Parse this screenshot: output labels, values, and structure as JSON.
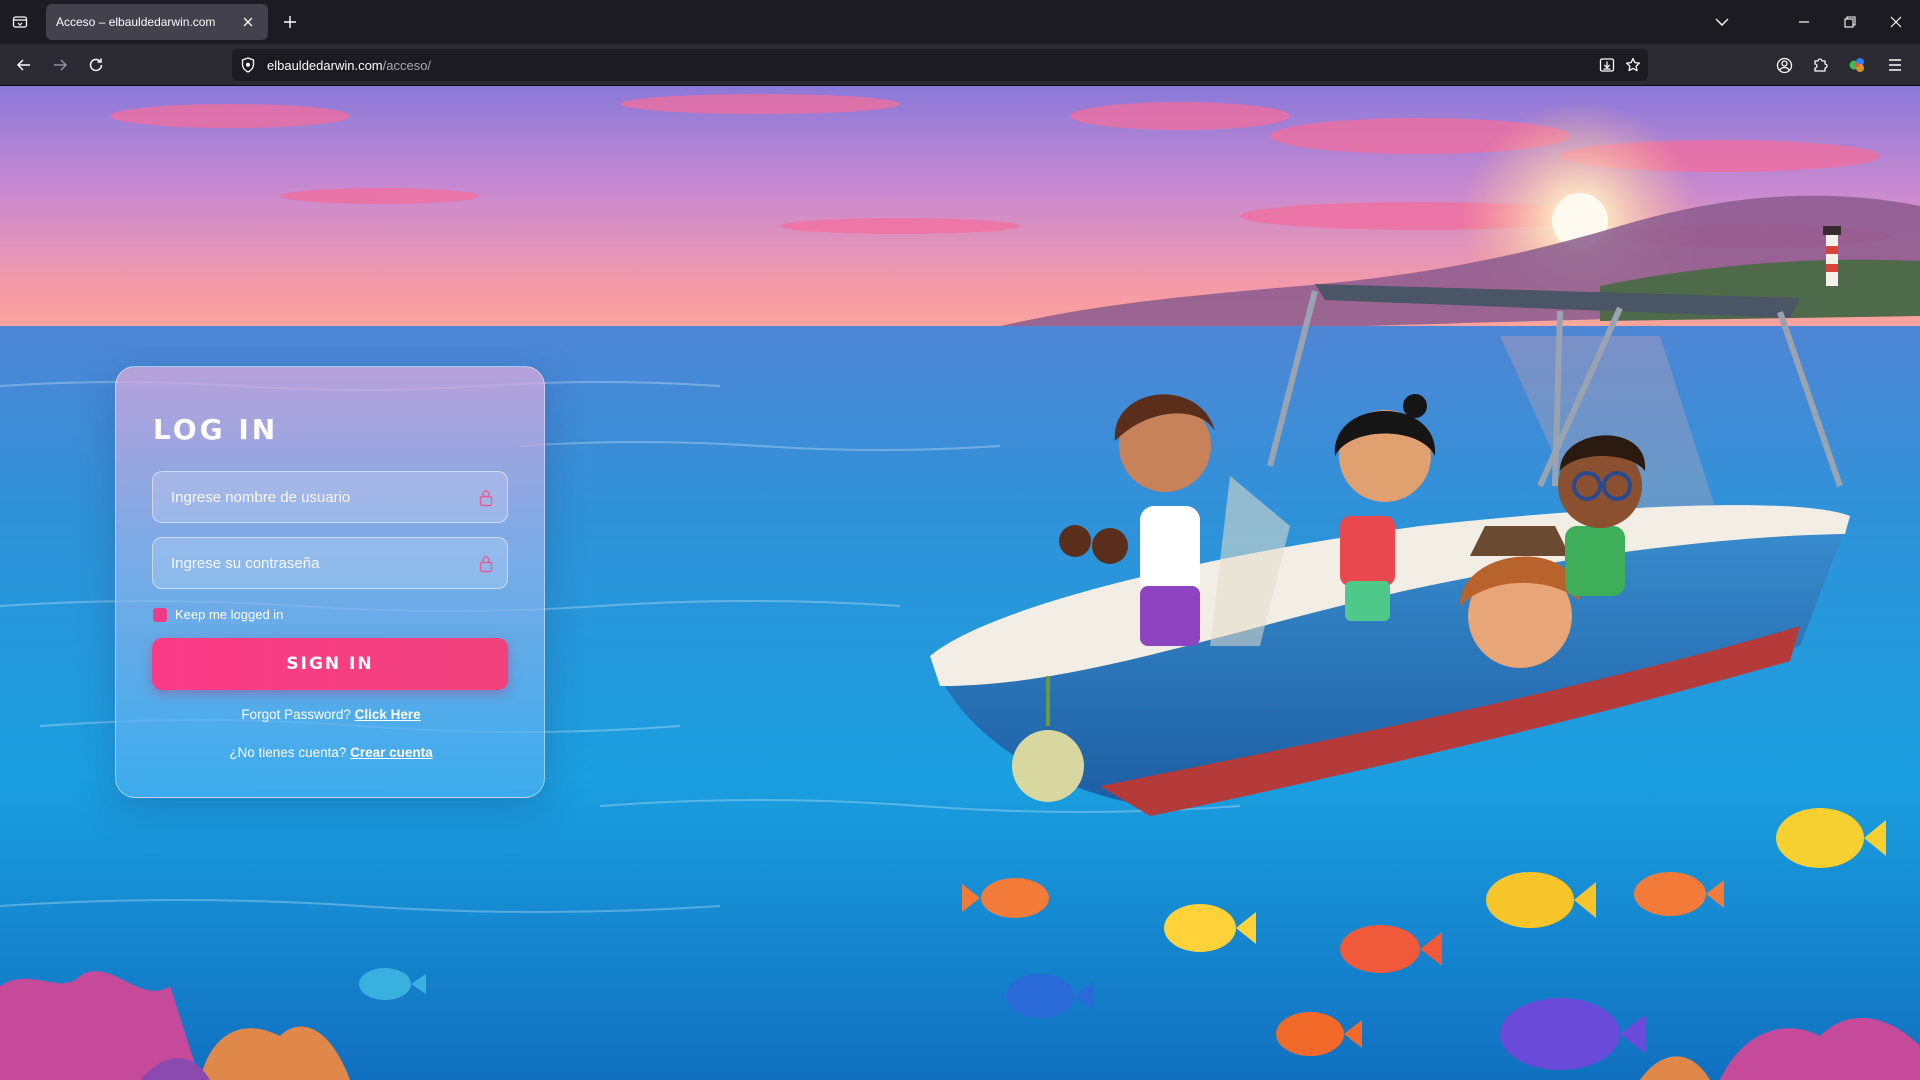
{
  "browser": {
    "tab_title": "Acceso – elbauldedarwin.com",
    "url_domain": "elbauldedarwin.com",
    "url_path": "/acceso/"
  },
  "icons": {
    "tablist": "tablist-icon",
    "close": "close-icon",
    "new_tab": "plus-icon",
    "back": "arrow-left-icon",
    "forward": "arrow-right-icon",
    "reload": "reload-icon",
    "shield": "shield-icon",
    "save_page": "save-page-icon",
    "bookmark": "star-icon",
    "account": "account-icon",
    "extensions": "puzzle-icon",
    "extension_colorful": "extension-icon",
    "menu": "hamburger-menu-icon",
    "lock": "lock-icon"
  },
  "login": {
    "title": "LOG IN",
    "username_placeholder": "Ingrese nombre de usuario",
    "password_placeholder": "Ingrese su contraseña",
    "remember_label": "Keep me logged in",
    "remember_checked": true,
    "submit_label": "SIGN IN",
    "forgot_text": "Forgot Password?",
    "forgot_link": "Click Here",
    "signup_text": "¿No tienes cuenta?",
    "signup_link": "Crear cuenta"
  },
  "colors": {
    "accent_pink": "#f53b83",
    "card_top": "#d6a8dc",
    "card_bottom": "#46aff0",
    "chrome_dark": "#1c1b22",
    "chrome_toolbar": "#2b2a33"
  }
}
